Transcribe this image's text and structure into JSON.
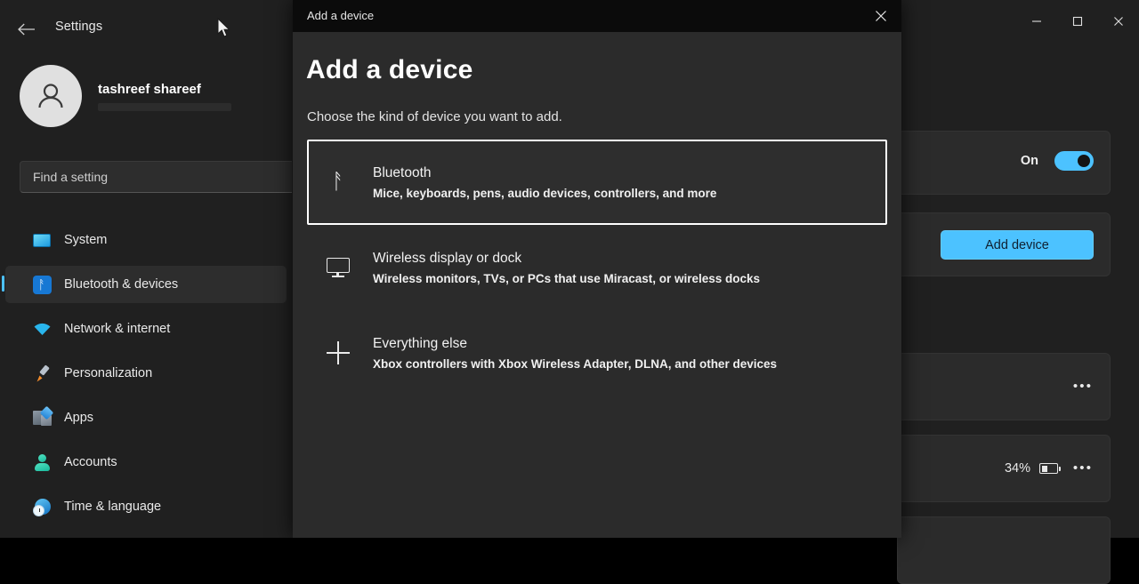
{
  "app": {
    "title": "Settings",
    "back_icon": "back-arrow-icon",
    "window_controls": {
      "minimize": "minimize-icon",
      "maximize": "maximize-icon",
      "close": "close-icon"
    }
  },
  "account": {
    "name": "tashreef shareef",
    "avatar_icon": "person-avatar-icon"
  },
  "search": {
    "placeholder": "Find a setting",
    "value": "",
    "icon": "search-icon"
  },
  "sidebar": {
    "items": [
      {
        "label": "System",
        "icon": "system-icon",
        "selected": false
      },
      {
        "label": "Bluetooth & devices",
        "icon": "bluetooth-icon",
        "selected": true
      },
      {
        "label": "Network & internet",
        "icon": "wifi-icon",
        "selected": false
      },
      {
        "label": "Personalization",
        "icon": "paintbrush-icon",
        "selected": false
      },
      {
        "label": "Apps",
        "icon": "apps-icon",
        "selected": false
      },
      {
        "label": "Accounts",
        "icon": "accounts-icon",
        "selected": false
      },
      {
        "label": "Time & language",
        "icon": "time-language-icon",
        "selected": false
      }
    ]
  },
  "content": {
    "bluetooth_toggle": {
      "state_label": "On",
      "enabled": true
    },
    "add_device_button": "Add device",
    "device_cards": [
      {
        "battery": "",
        "more_icon": "more-options-icon"
      },
      {
        "battery": "34%",
        "battery_icon": "battery-low-icon",
        "more_icon": "more-options-icon"
      }
    ]
  },
  "dialog": {
    "titlebar": "Add a device",
    "close_icon": "close-icon",
    "heading": "Add a device",
    "subheading": "Choose the kind of device you want to add.",
    "options": [
      {
        "title": "Bluetooth",
        "description": "Mice, keyboards, pens, audio devices, controllers, and more",
        "icon": "bluetooth-icon",
        "focused": true
      },
      {
        "title": "Wireless display or dock",
        "description": "Wireless monitors, TVs, or PCs that use Miracast, or wireless docks",
        "icon": "monitor-icon",
        "focused": false
      },
      {
        "title": "Everything else",
        "description": "Xbox controllers with Xbox Wireless Adapter, DLNA, and other devices",
        "icon": "plus-icon",
        "focused": false
      }
    ]
  },
  "colors": {
    "accent": "#4cc2ff",
    "window_bg": "#202020",
    "card_bg": "#2b2b2b",
    "dialog_titlebar": "#0b0b0b",
    "focus_border": "#ffffff"
  }
}
